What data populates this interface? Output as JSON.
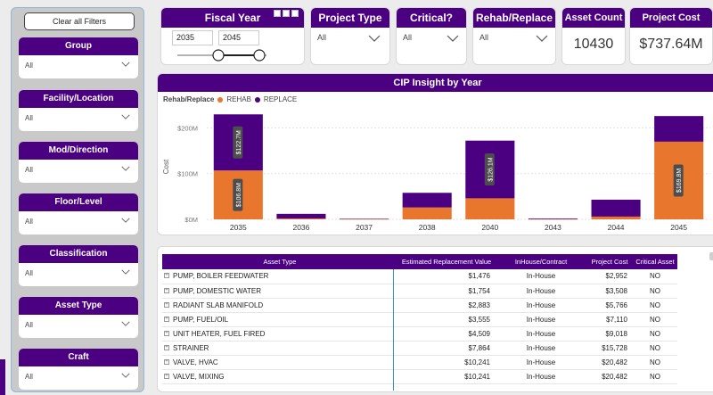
{
  "colors": {
    "accent": "#4b0082",
    "rehab": "#e8762d",
    "replace": "#4b0082",
    "highlight": "#3a8fd6"
  },
  "left_panel": {
    "clear_label": "Clear all Filters",
    "filters": [
      {
        "label": "Group",
        "value": "All"
      },
      {
        "label": "Facility/Location",
        "value": "All"
      },
      {
        "label": "Mod/Direction",
        "value": "All"
      },
      {
        "label": "Floor/Level",
        "value": "All"
      },
      {
        "label": "Classification",
        "value": "All"
      },
      {
        "label": "Asset Type",
        "value": "All"
      },
      {
        "label": "Craft",
        "value": "All"
      }
    ]
  },
  "slicers": {
    "fiscal_year": {
      "title": "Fiscal Year",
      "from": "2035",
      "to": "2045"
    },
    "project_type": {
      "title": "Project Type",
      "value": "All"
    },
    "critical": {
      "title": "Critical?",
      "value": "All"
    },
    "rehab_replace": {
      "title": "Rehab/Replace",
      "value": "All"
    }
  },
  "kpis": {
    "asset_count": {
      "title": "Asset Count",
      "value": "10430"
    },
    "project_cost": {
      "title": "Project Cost",
      "value": "$737.64M"
    }
  },
  "chart_data": {
    "type": "bar",
    "stacked": true,
    "title": "CIP Insight by Year",
    "legend_title": "Rehab/Replace",
    "legend_position": "top-left",
    "ylabel": "Cost",
    "ylim": [
      0,
      230
    ],
    "yticks": [
      {
        "value": 0,
        "label": "$0M"
      },
      {
        "value": 100,
        "label": "$100M"
      },
      {
        "value": 200,
        "label": "$200M"
      }
    ],
    "categories": [
      "2035",
      "2036",
      "2037",
      "2038",
      "2040",
      "2043",
      "2044",
      "2045"
    ],
    "series": [
      {
        "name": "REHAB",
        "values": [
          106.8,
          2,
          0.5,
          26,
          46,
          0.5,
          6,
          169.8
        ]
      },
      {
        "name": "REPLACE",
        "values": [
          122.7,
          10,
          1,
          32,
          126.1,
          1.5,
          37,
          56
        ]
      }
    ],
    "data_labels": [
      {
        "category": "2035",
        "series": "REHAB",
        "text": "$106.8M"
      },
      {
        "category": "2035",
        "series": "REPLACE",
        "text": "$122.7M"
      },
      {
        "category": "2040",
        "series": "REPLACE",
        "text": "$126.1M"
      },
      {
        "category": "2045",
        "series": "REHAB",
        "text": "$169.8M"
      }
    ],
    "grid": true
  },
  "table": {
    "columns": [
      "Asset Type",
      "Estimated Replacement Value",
      "InHouse/Contract",
      "Project Cost",
      "Critical Asset"
    ],
    "rows": [
      {
        "asset": "PUMP, BOILER FEEDWATER",
        "value": "$1,476",
        "house": "In-House",
        "cost": "$2,952",
        "critical": "NO"
      },
      {
        "asset": "PUMP, DOMESTIC WATER",
        "value": "$1,754",
        "house": "In-House",
        "cost": "$3,508",
        "critical": "NO"
      },
      {
        "asset": "RADIANT SLAB MANIFOLD",
        "value": "$2,883",
        "house": "In-House",
        "cost": "$5,766",
        "critical": "NO"
      },
      {
        "asset": "PUMP, FUEL/OIL",
        "value": "$3,555",
        "house": "In-House",
        "cost": "$7,110",
        "critical": "NO"
      },
      {
        "asset": "UNIT HEATER, FUEL FIRED",
        "value": "$4,509",
        "house": "In-House",
        "cost": "$9,018",
        "critical": "NO"
      },
      {
        "asset": "STRAINER",
        "value": "$7,864",
        "house": "In-House",
        "cost": "$15,728",
        "critical": "NO"
      },
      {
        "asset": "VALVE, HVAC",
        "value": "$10,241",
        "house": "In-House",
        "cost": "$20,482",
        "critical": "NO"
      },
      {
        "asset": "VALVE, MIXING",
        "value": "$10,241",
        "house": "In-House",
        "cost": "$20,482",
        "critical": "NO"
      }
    ]
  }
}
